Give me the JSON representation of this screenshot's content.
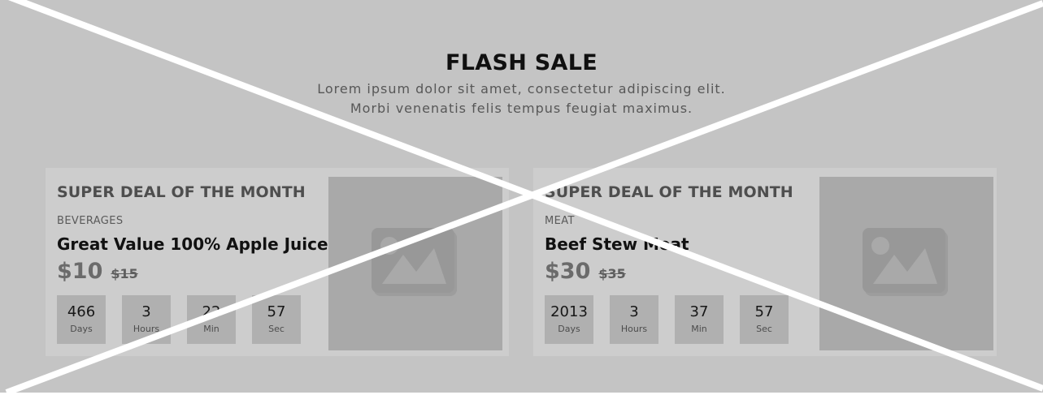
{
  "hero": {
    "title": "FLASH SALE",
    "subtitle_line1": "Lorem ipsum dolor sit amet, consectetur adipiscing elit.",
    "subtitle_line2": "Morbi venenatis felis tempus feugiat maximus."
  },
  "deals": [
    {
      "heading": "SUPER DEAL OF THE MONTH",
      "category": "BEVERAGES",
      "product": "Great Value 100% Apple Juice",
      "price": "$10",
      "old_price": "$15",
      "countdown": [
        {
          "value": "466",
          "label": "Days"
        },
        {
          "value": "3",
          "label": "Hours"
        },
        {
          "value": "22",
          "label": "Min"
        },
        {
          "value": "57",
          "label": "Sec"
        }
      ],
      "image_icon": "image-icon"
    },
    {
      "heading": "SUPER DEAL OF THE MONTH",
      "category": "MEAT",
      "product": "Beef Stew Meat",
      "price": "$30",
      "old_price": "$35",
      "countdown": [
        {
          "value": "2013",
          "label": "Days"
        },
        {
          "value": "3",
          "label": "Hours"
        },
        {
          "value": "37",
          "label": "Min"
        },
        {
          "value": "57",
          "label": "Sec"
        }
      ],
      "image_icon": "image-icon"
    }
  ],
  "colors": {
    "background": "#c4c4c4",
    "card": "#cdcdcd",
    "countdown_box": "#b0b0b0",
    "image_placeholder": "#a9a9a9",
    "placeholder_icon": "#989898",
    "crossing_lines": "#ffffff"
  }
}
